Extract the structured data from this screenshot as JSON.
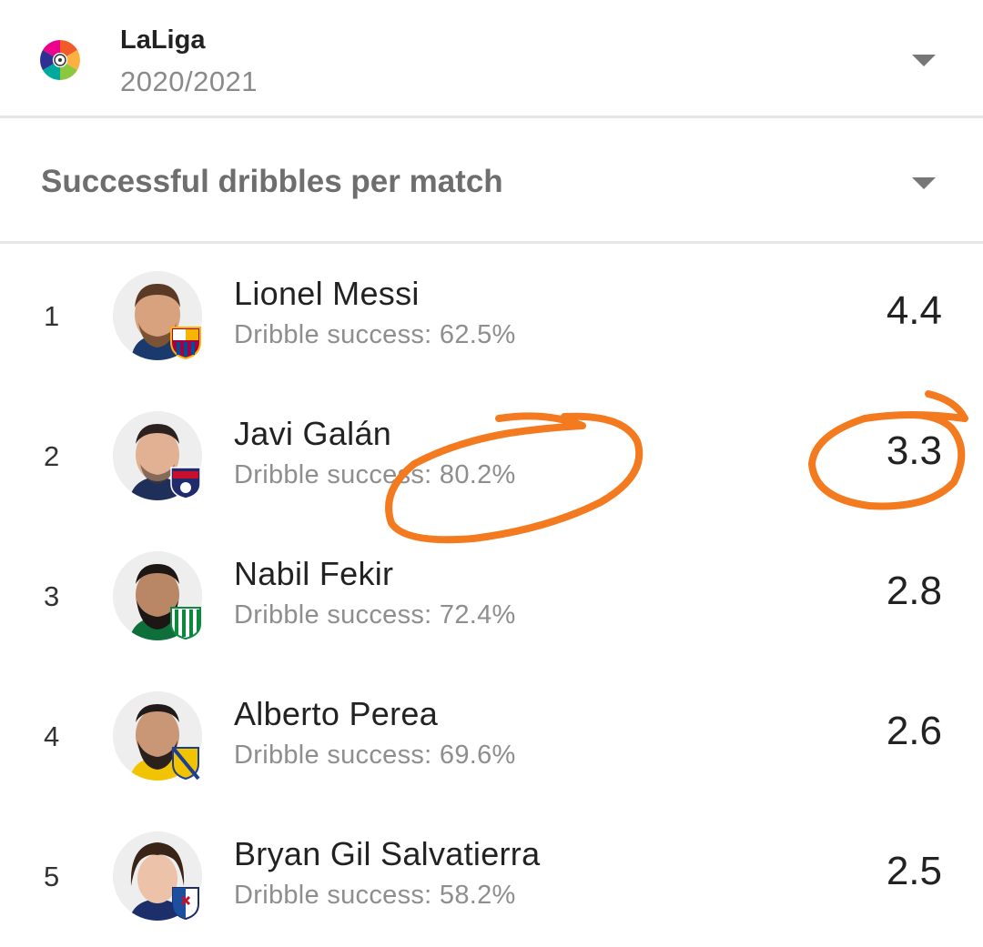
{
  "league": {
    "name": "LaLiga",
    "season": "2020/2021",
    "logo_icon": "laliga-logo-icon",
    "dropdown_icon": "chevron-down-icon"
  },
  "stat": {
    "title": "Successful dribbles per match",
    "dropdown_icon": "chevron-down-icon"
  },
  "players": [
    {
      "rank": "1",
      "name": "Lionel Messi",
      "sub": "Dribble success: 62.5%",
      "value": "4.4",
      "club_badge": "barcelona-badge-icon"
    },
    {
      "rank": "2",
      "name": "Javi Galán",
      "sub": "Dribble success: 80.2%",
      "value": "3.3",
      "club_badge": "huesca-badge-icon"
    },
    {
      "rank": "3",
      "name": "Nabil Fekir",
      "sub": "Dribble success: 72.4%",
      "value": "2.8",
      "club_badge": "betis-badge-icon"
    },
    {
      "rank": "4",
      "name": "Alberto Perea",
      "sub": "Dribble success: 69.6%",
      "value": "2.6",
      "club_badge": "cadiz-badge-icon"
    },
    {
      "rank": "5",
      "name": "Bryan Gil Salvatierra",
      "sub": "Dribble success: 58.2%",
      "value": "2.5",
      "club_badge": "eibar-badge-icon"
    }
  ],
  "colors": {
    "annotation": "#f47a20",
    "text_primary": "#222222",
    "text_secondary": "#8e8e8e",
    "divider": "#e6e6e6"
  }
}
